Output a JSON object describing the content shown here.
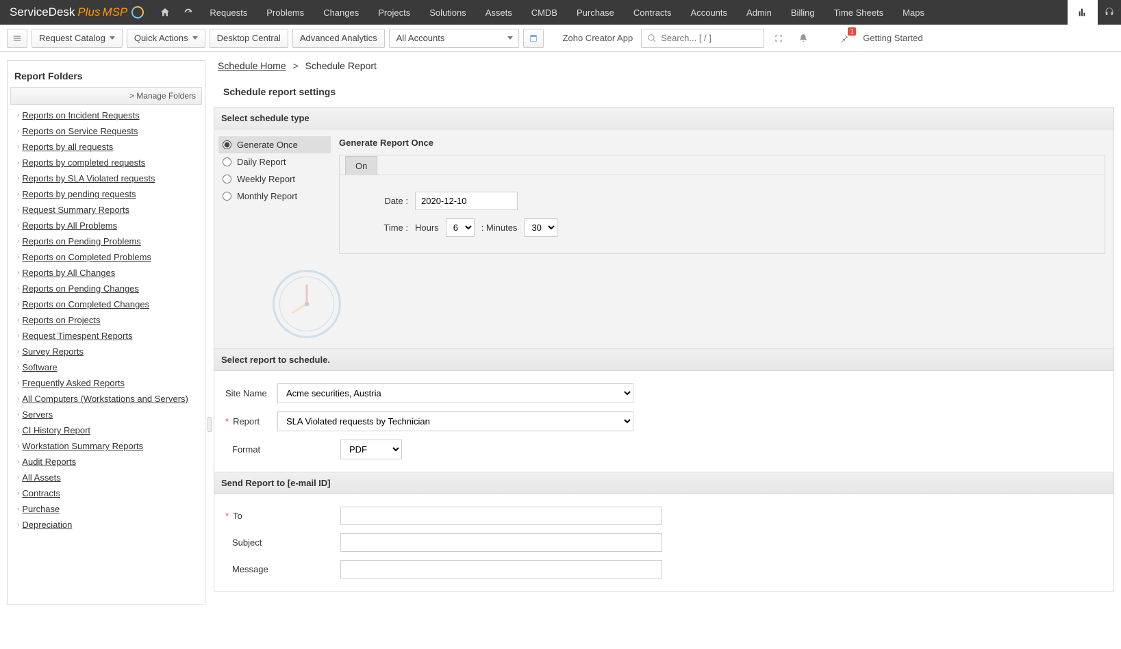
{
  "brand": {
    "main": "ServiceDesk",
    "plus": "Plus",
    "msp": "MSP"
  },
  "topnav": [
    "Requests",
    "Problems",
    "Changes",
    "Projects",
    "Solutions",
    "Assets",
    "CMDB",
    "Purchase",
    "Contracts",
    "Accounts",
    "Admin",
    "Billing",
    "Time Sheets",
    "Maps"
  ],
  "subbar": {
    "request_catalog": "Request Catalog",
    "quick_actions": "Quick Actions",
    "desktop_central": "Desktop Central",
    "advanced_analytics": "Advanced Analytics",
    "all_accounts": "All Accounts",
    "zoho_creator": "Zoho Creator App",
    "search_placeholder": "Search... [ / ]",
    "getting_started": "Getting Started",
    "pin_badge": "1"
  },
  "sidebar": {
    "title": "Report Folders",
    "manage": "> Manage Folders",
    "folders": [
      "Reports on Incident Requests",
      "Reports on Service Requests",
      "Reports by all requests",
      "Reports by completed requests",
      "Reports by SLA Violated requests",
      "Reports by pending requests",
      "Request Summary Reports",
      "Reports by All Problems",
      "Reports on Pending Problems",
      "Reports on Completed Problems",
      "Reports by All Changes",
      "Reports on Pending Changes",
      "Reports on Completed Changes",
      "Reports on Projects",
      "Request Timespent Reports",
      "Survey Reports",
      "Software",
      "Frequently Asked Reports",
      "All Computers (Workstations and Servers)",
      "Servers",
      "CI History Report",
      "Workstation Summary Reports",
      "Audit Reports",
      "All Assets",
      "Contracts",
      "Purchase",
      "Depreciation"
    ]
  },
  "breadcrumb": {
    "home": "Schedule Home",
    "sep": ">",
    "current": "Schedule Report"
  },
  "page_title": "Schedule report settings",
  "schedule_type": {
    "header": "Select schedule type",
    "options": [
      "Generate Once",
      "Daily Report",
      "Weekly Report",
      "Monthly Report"
    ],
    "selected_index": 0,
    "right_title": "Generate Report Once",
    "on_tab": "On",
    "date_label": "Date :",
    "date_value": "2020-12-10",
    "time_label": "Time :",
    "hours_label": "Hours",
    "hours_value": "6",
    "minutes_sep": ": Minutes",
    "minutes_value": "30"
  },
  "report_select": {
    "header": "Select report to schedule.",
    "site_label": "Site Name",
    "site_value": "Acme securities, Austria",
    "report_label": "Report",
    "report_value": "SLA Violated requests by Technician",
    "format_label": "Format",
    "format_value": "PDF"
  },
  "send_report": {
    "header": "Send Report to [e-mail ID]",
    "to_label": "To",
    "to_value": "",
    "subject_label": "Subject",
    "subject_value": "",
    "message_label": "Message",
    "message_value": ""
  }
}
